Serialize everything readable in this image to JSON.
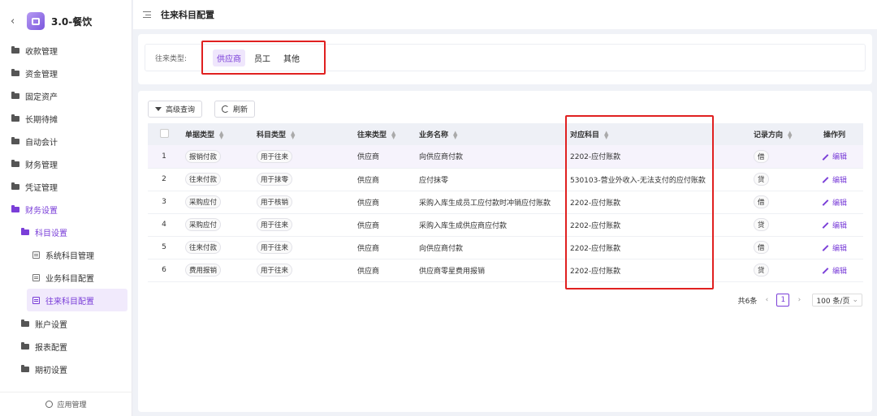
{
  "app": {
    "title": "3.0-餐饮",
    "back_icon": "back-arrow-icon"
  },
  "sidebar": {
    "items": [
      {
        "label": "收款管理"
      },
      {
        "label": "资金管理"
      },
      {
        "label": "固定资产"
      },
      {
        "label": "长期待摊"
      },
      {
        "label": "自动会计"
      },
      {
        "label": "财务管理"
      },
      {
        "label": "凭证管理"
      },
      {
        "label": "财务设置"
      },
      {
        "label": "科目设置"
      },
      {
        "label": "系统科目管理"
      },
      {
        "label": "业务科目配置"
      },
      {
        "label": "往来科目配置"
      },
      {
        "label": "账户设置"
      },
      {
        "label": "报表配置"
      },
      {
        "label": "期初设置"
      }
    ],
    "footer_label": "应用管理"
  },
  "header": {
    "title": "往来科目配置"
  },
  "filter": {
    "label": "往来类型:",
    "options": [
      "供应商",
      "员工",
      "其他"
    ],
    "selected": "供应商"
  },
  "toolbar": {
    "advanced_search": "高级查询",
    "refresh": "刷新"
  },
  "table": {
    "columns": [
      "单据类型",
      "科目类型",
      "往来类型",
      "业务名称",
      "对应科目",
      "记录方向",
      "操作列"
    ],
    "rows": [
      {
        "no": "1",
        "doc_type": "报销付款",
        "subject_type": "用于往来",
        "partner_type": "供应商",
        "business": "向供应商付款",
        "subject": "2202-应付账款",
        "direction": "借",
        "action": "编辑"
      },
      {
        "no": "2",
        "doc_type": "往来付款",
        "subject_type": "用于抹零",
        "partner_type": "供应商",
        "business": "应付抹零",
        "subject": "530103-营业外收入-无法支付的应付账款",
        "direction": "贷",
        "action": "编辑"
      },
      {
        "no": "3",
        "doc_type": "采购应付",
        "subject_type": "用于核销",
        "partner_type": "供应商",
        "business": "采购入库生成员工应付款时冲销应付账款",
        "subject": "2202-应付账款",
        "direction": "借",
        "action": "编辑"
      },
      {
        "no": "4",
        "doc_type": "采购应付",
        "subject_type": "用于往来",
        "partner_type": "供应商",
        "business": "采购入库生成供应商应付款",
        "subject": "2202-应付账款",
        "direction": "贷",
        "action": "编辑"
      },
      {
        "no": "5",
        "doc_type": "往来付款",
        "subject_type": "用于往来",
        "partner_type": "供应商",
        "business": "向供应商付款",
        "subject": "2202-应付账款",
        "direction": "借",
        "action": "编辑"
      },
      {
        "no": "6",
        "doc_type": "费用报销",
        "subject_type": "用于往来",
        "partner_type": "供应商",
        "business": "供应商零星费用报销",
        "subject": "2202-应付账款",
        "direction": "贷",
        "action": "编辑"
      }
    ]
  },
  "pagination": {
    "total": "共6条",
    "current": "1",
    "page_size": "100 条/页"
  }
}
